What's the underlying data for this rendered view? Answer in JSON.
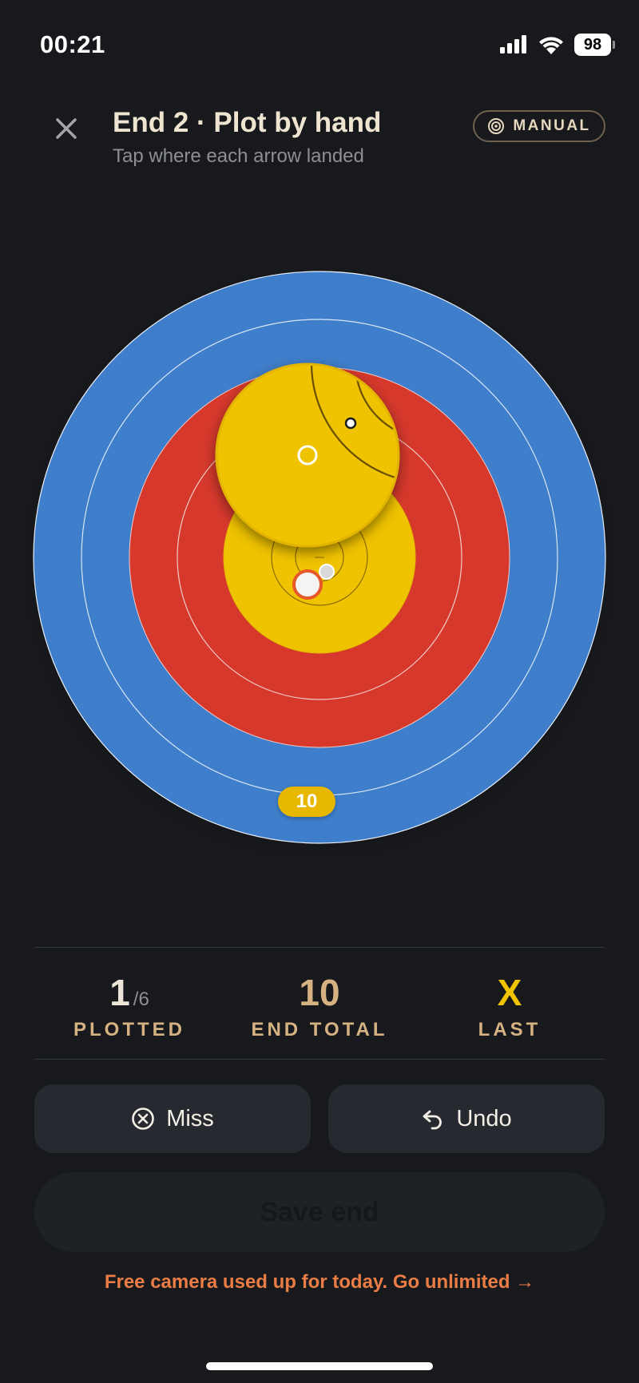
{
  "status_bar": {
    "time": "00:21",
    "battery": "98"
  },
  "header": {
    "title": "End 2 · Plot by hand",
    "subtitle": "Tap where each arrow landed",
    "mode_badge": "MANUAL"
  },
  "target": {
    "score_bubble": "10",
    "ring_colors": {
      "blue": "#3f7ecb",
      "red": "#d6392c",
      "gold": "#f0c300"
    },
    "magnifier_visible": true
  },
  "stats": {
    "plotted": {
      "value": "1",
      "suffix": "/6",
      "label": "PLOTTED"
    },
    "end_total": {
      "value": "10",
      "label": "END TOTAL"
    },
    "last": {
      "value": "X",
      "label": "LAST"
    }
  },
  "actions": {
    "miss_label": "Miss",
    "undo_label": "Undo",
    "save_label": "Save end"
  },
  "upsell": {
    "text": "Free camera used up for today. Go unlimited →"
  },
  "colors": {
    "background": "#17191d",
    "accent_gold": "#d6b282",
    "accent_orange": "#ea7d45",
    "x_yellow": "#f1c400"
  },
  "icons": {
    "close": "close-icon",
    "mode": "target-icon",
    "miss": "circle-x-icon",
    "undo": "undo-icon"
  }
}
